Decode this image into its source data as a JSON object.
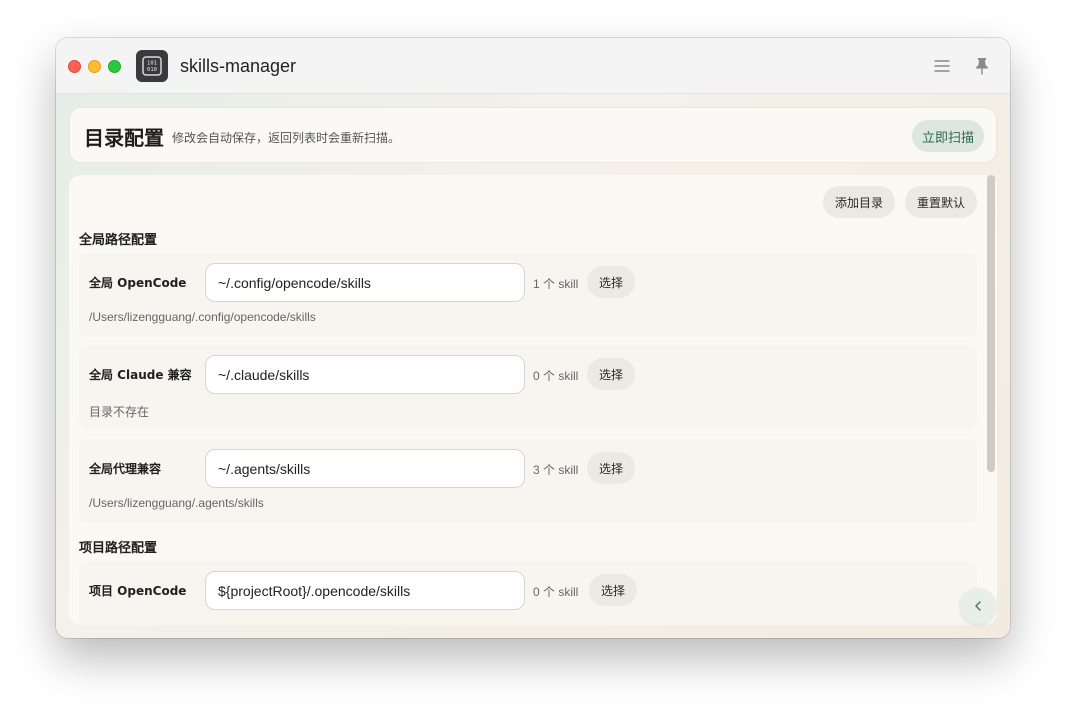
{
  "window": {
    "app_title": "skills-manager",
    "icons": {
      "app": "binary-code-icon",
      "menu": "menu-icon",
      "pin": "pin-icon",
      "back": "chevron-left-icon"
    }
  },
  "header": {
    "title": "目录配置",
    "subtitle": "修改会自动保存，返回列表时会重新扫描。",
    "scan_label": "立即扫描"
  },
  "toolbar": {
    "add_label": "添加目录",
    "reset_label": "重置默认"
  },
  "sections": {
    "global_title": "全局路径配置",
    "project_title": "项目路径配置"
  },
  "global_rows": [
    {
      "label": "全局 OpenCode",
      "value": "~/.config/opencode/skills",
      "count": "1 个 skill",
      "select_label": "选择",
      "path": "/Users/lizengguang/.config/opencode/skills"
    },
    {
      "label": "全局 Claude 兼容",
      "value": "~/.claude/skills",
      "count": "0 个 skill",
      "select_label": "选择",
      "path": "目录不存在"
    },
    {
      "label": "全局代理兼容",
      "value": "~/.agents/skills",
      "count": "3 个 skill",
      "select_label": "选择",
      "path": "/Users/lizengguang/.agents/skills"
    }
  ],
  "project_rows": [
    {
      "label": "项目 OpenCode",
      "value": "${projectRoot}/.opencode/skills",
      "count": "0 个 skill",
      "select_label": "选择"
    }
  ],
  "colors": {
    "accent_text": "#2d6a54",
    "accent_bg": "#dde7df"
  }
}
